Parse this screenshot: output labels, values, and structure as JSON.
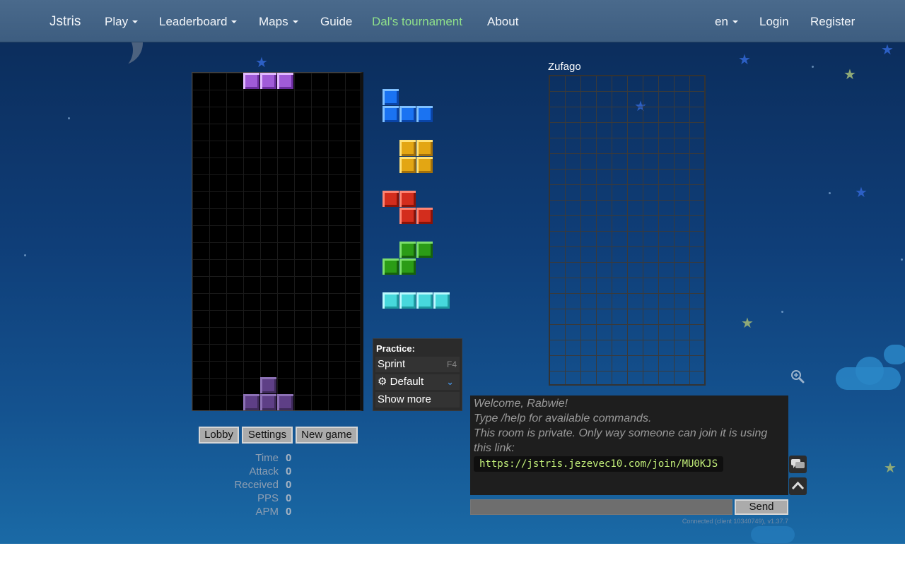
{
  "nav": {
    "brand": "Jstris",
    "items": [
      {
        "label": "Play",
        "dropdown": true
      },
      {
        "label": "Leaderboard",
        "dropdown": true
      },
      {
        "label": "Maps",
        "dropdown": true
      },
      {
        "label": "Guide",
        "dropdown": false
      },
      {
        "label": "Dal's tournament",
        "dropdown": false
      },
      {
        "label": "About",
        "dropdown": false
      }
    ],
    "language": "en",
    "login": "Login",
    "register": "Register",
    "tournament_color": "#8fe08a"
  },
  "game": {
    "active_piece": "T",
    "active_piece_color": "#a05bd8",
    "ghost_piece": "T",
    "queue": [
      {
        "piece": "J",
        "color": "#1a73f2"
      },
      {
        "piece": "O",
        "color": "#e3a613"
      },
      {
        "piece": "Z",
        "color": "#d32d1d"
      },
      {
        "piece": "S",
        "color": "#2b9c16"
      },
      {
        "piece": "I",
        "color": "#47d8dc"
      }
    ]
  },
  "practice": {
    "title": "Practice:",
    "sprint": "Sprint",
    "sprint_key": "F4",
    "preset": "Default",
    "show_more": "Show more"
  },
  "buttons": {
    "lobby": "Lobby",
    "settings": "Settings",
    "new_game": "New game"
  },
  "stats": [
    {
      "label": "Time",
      "value": "0"
    },
    {
      "label": "Attack",
      "value": "0"
    },
    {
      "label": "Received",
      "value": "0"
    },
    {
      "label": "PPS",
      "value": "0"
    },
    {
      "label": "APM",
      "value": "0"
    }
  ],
  "opponent": {
    "name": "Zufago"
  },
  "chat": {
    "lines": [
      "Welcome, Rabwie!",
      "Type /help for available commands.",
      "This room is private. Only way someone can join it is using this link:"
    ],
    "link": "https://jstris.jezevec10.com/join/MU0KJS",
    "send": "Send",
    "status": "Connected (client 10340749), v1.37.7"
  },
  "icons": {
    "zoom": "zoom-in-icon",
    "chat_toggle": "chat-bubbles-icon",
    "scroll_up": "chevron-up-icon",
    "settings_gear": "gear-icon",
    "dropdown": "chevron-down-icon"
  }
}
